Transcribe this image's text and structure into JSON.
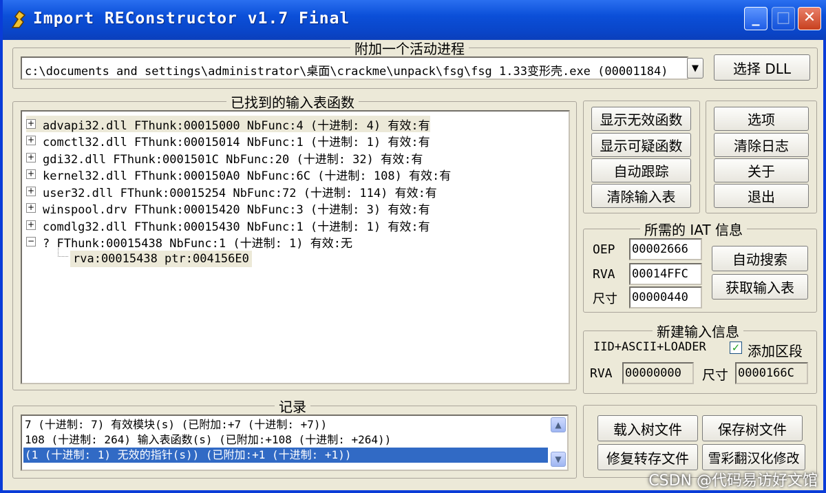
{
  "title": "Import REConstructor v1.7 Final",
  "titlebar_buttons": {
    "minimize": "_",
    "maximize": "□",
    "close": "✕"
  },
  "attach": {
    "legend": "附加一个活动进程",
    "process_value": "c:\\documents and settings\\administrator\\桌面\\crackme\\unpack\\fsg\\fsg 1.33变形壳.exe  (00001184)",
    "pick_dll_label": "选择 DLL"
  },
  "imports": {
    "legend": "已找到的输入表函数",
    "rows": [
      {
        "expander": "+",
        "text": "advapi32.dll FThunk:00015000 NbFunc:4 (十进制: 4) 有效:有"
      },
      {
        "expander": "+",
        "text": "comctl32.dll FThunk:00015014 NbFunc:1 (十进制: 1) 有效:有"
      },
      {
        "expander": "+",
        "text": "gdi32.dll FThunk:0001501C NbFunc:20 (十进制: 32) 有效:有"
      },
      {
        "expander": "+",
        "text": "kernel32.dll FThunk:000150A0 NbFunc:6C (十进制: 108) 有效:有"
      },
      {
        "expander": "+",
        "text": "user32.dll FThunk:00015254 NbFunc:72 (十进制: 114) 有效:有"
      },
      {
        "expander": "+",
        "text": "winspool.drv FThunk:00015420 NbFunc:3 (十进制: 3) 有效:有"
      },
      {
        "expander": "+",
        "text": "comdlg32.dll FThunk:00015430 NbFunc:1 (十进制: 1) 有效:有"
      },
      {
        "expander": "−",
        "text": "? FThunk:00015438 NbFunc:1 (十进制: 1) 有效:无"
      }
    ],
    "child_row": "rva:00015438 ptr:004156E0"
  },
  "func_buttons": {
    "show_invalid": "显示无效函数",
    "show_suspect": "显示可疑函数",
    "auto_trace": "自动跟踪",
    "clear_imports": "清除输入表"
  },
  "misc_buttons": {
    "options": "选项",
    "clear_log": "清除日志",
    "about": "关于",
    "exit": "退出"
  },
  "iat": {
    "legend": "所需的 IAT 信息",
    "oep_label": "OEP",
    "oep_value": "00002666",
    "rva_label": "RVA",
    "rva_value": "00014FFC",
    "size_label": "尺寸",
    "size_value": "00000440",
    "auto_search": "自动搜索",
    "get_imports": "获取输入表"
  },
  "new_import": {
    "legend": "新建输入信息",
    "iid_label": "IID+ASCII+LOADER",
    "add_section_label": "添加区段",
    "add_section_checked": "✓",
    "rva_label": "RVA",
    "rva_value": "00000000",
    "size_label": "尺寸",
    "size_value": "0000166C"
  },
  "log": {
    "legend": "记录",
    "lines": [
      "7 (十进制: 7) 有效模块(s) (已附加:+7 (十进制: +7))",
      "108 (十进制: 264) 输入表函数(s) (已附加:+108 (十进制: +264))",
      "(1 (十进制: 1) 无效的指针(s)) (已附加:+1 (十进制: +1))"
    ],
    "scroll_up": "▲",
    "scroll_down": "▼"
  },
  "tree_buttons": {
    "load_tree": "载入树文件",
    "save_tree": "保存树文件",
    "fix_dump": "修复转存文件",
    "partial": "雪彩翻汉化修改"
  },
  "watermark": "CSDN @代码易访好文馆"
}
